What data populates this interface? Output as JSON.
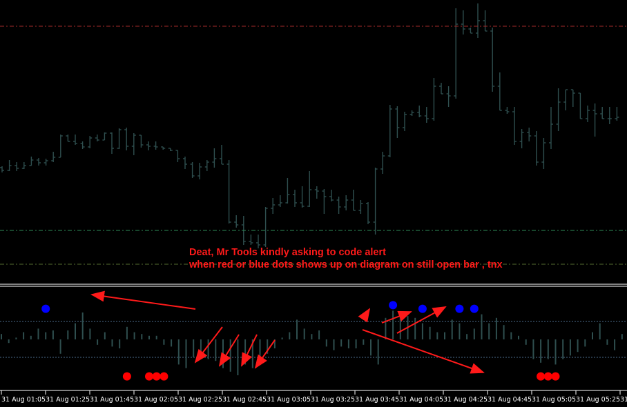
{
  "colors": {
    "background": "#000000",
    "price_bar": "#2f4f4f",
    "resistance_line": "#a52a2a",
    "support_line": "#2e8b57",
    "support_line_2": "#556b2f",
    "separator": "#ffffff",
    "histogram": "#2f4f4f",
    "level_line": "#4b6b8b",
    "dot_up": "#0000ff",
    "dot_down": "#ff0000",
    "annotation": "#ff1a1a",
    "axis_text": "#ffffff"
  },
  "annotation": {
    "line1": "Deat, Mr Tools kindly asking to code alert",
    "line2": "when red or blue dots shows up on diagram on still open bar , tnx"
  },
  "x_axis": {
    "labels": [
      "31 Aug 01:05",
      "31 Aug 01:25",
      "31 Aug 01:45",
      "31 Aug 02:05",
      "31 Aug 02:25",
      "31 Aug 02:45",
      "31 Aug 03:05",
      "31 Aug 03:25",
      "31 Aug 03:45",
      "31 Aug 04:05",
      "31 Aug 04:25",
      "31 Aug 04:45",
      "31 Aug 05:05",
      "31 Aug 05:25",
      "31"
    ]
  },
  "chart_data": [
    {
      "type": "bar",
      "description_free": true,
      "bar_interval_minutes": 1,
      "first_bar_time": "31 Aug 01:05",
      "ohlc": [
        [
          243,
          250,
          241,
          247
        ],
        [
          247,
          248,
          232,
          240
        ],
        [
          240,
          248,
          235,
          244
        ],
        [
          244,
          245,
          235,
          240
        ],
        [
          240,
          240,
          227,
          232
        ],
        [
          232,
          240,
          229,
          236
        ],
        [
          236,
          240,
          230,
          233
        ],
        [
          233,
          235,
          220,
          228
        ],
        [
          228,
          228,
          195,
          197
        ],
        [
          197,
          205,
          195,
          205
        ],
        [
          205,
          210,
          195,
          208
        ],
        [
          208,
          216,
          205,
          213
        ],
        [
          213,
          215,
          197,
          200
        ],
        [
          200,
          205,
          195,
          203
        ],
        [
          203,
          203,
          192,
          193
        ],
        [
          193,
          223,
          192,
          215
        ],
        [
          215,
          216,
          186,
          188
        ],
        [
          188,
          218,
          185,
          212
        ],
        [
          212,
          225,
          193,
          196
        ],
        [
          196,
          214,
          196,
          210
        ],
        [
          210,
          218,
          205,
          212
        ],
        [
          212,
          217,
          205,
          213
        ],
        [
          213,
          217,
          213,
          215
        ],
        [
          215,
          215,
          219,
          218
        ],
        [
          218,
          218,
          235,
          230
        ],
        [
          230,
          245,
          227,
          238
        ],
        [
          238,
          258,
          235,
          255
        ],
        [
          255,
          260,
          236,
          242
        ],
        [
          242,
          248,
          232,
          235
        ],
        [
          235,
          243,
          215,
          230
        ],
        [
          230,
          234,
          210,
          238
        ],
        [
          238,
          324,
          232,
          322
        ],
        [
          322,
          330,
          312,
          326
        ],
        [
          326,
          355,
          313,
          350
        ],
        [
          350,
          355,
          340,
          352
        ],
        [
          352,
          360,
          340,
          355
        ],
        [
          355,
          358,
          300,
          302
        ],
        [
          302,
          310,
          287,
          297
        ],
        [
          297,
          300,
          283,
          294
        ],
        [
          294,
          295,
          258,
          282
        ],
        [
          282,
          300,
          275,
          294
        ],
        [
          294,
          301,
          270,
          299
        ],
        [
          299,
          300,
          248,
          275
        ],
        [
          275,
          288,
          270,
          277
        ],
        [
          277,
          310,
          274,
          285
        ],
        [
          285,
          292,
          275,
          290
        ],
        [
          290,
          310,
          285,
          300
        ],
        [
          300,
          305,
          283,
          290
        ],
        [
          290,
          305,
          275,
          305
        ],
        [
          305,
          310,
          290,
          295
        ],
        [
          295,
          325,
          293,
          322
        ],
        [
          322,
          340,
          243,
          245
        ],
        [
          245,
          252,
          220,
          226
        ],
        [
          226,
          228,
          152,
          158
        ],
        [
          158,
          200,
          154,
          185
        ],
        [
          185,
          190,
          162,
          166
        ],
        [
          166,
          168,
          160,
          163
        ],
        [
          163,
          170,
          153,
          168
        ],
        [
          168,
          178,
          155,
          172
        ],
        [
          172,
          175,
          113,
          125
        ],
        [
          125,
          132,
          120,
          136
        ],
        [
          136,
          155,
          125,
          139
        ],
        [
          139,
          143,
          12,
          35
        ],
        [
          35,
          50,
          15,
          42
        ],
        [
          42,
          48,
          40,
          48
        ],
        [
          48,
          55,
          5,
          30
        ],
        [
          30,
          40,
          15,
          45
        ],
        [
          45,
          133,
          40,
          125
        ],
        [
          125,
          130,
          105,
          160
        ],
        [
          160,
          165,
          155,
          162
        ],
        [
          162,
          210,
          155,
          205
        ],
        [
          205,
          215,
          187,
          192
        ],
        [
          192,
          205,
          185,
          197
        ],
        [
          197,
          240,
          190,
          235
        ],
        [
          235,
          245,
          200,
          207
        ],
        [
          207,
          216,
          155,
          180
        ],
        [
          180,
          190,
          128,
          148
        ],
        [
          148,
          160,
          130,
          130
        ],
        [
          130,
          155,
          130,
          135
        ],
        [
          135,
          165,
          150,
          172
        ],
        [
          172,
          177,
          153,
          160
        ],
        [
          160,
          198,
          150,
          165
        ],
        [
          165,
          172,
          155,
          172
        ],
        [
          172,
          180,
          155,
          172
        ],
        [
          172,
          175,
          155,
          170
        ]
      ]
    },
    {
      "type": "bar",
      "description_free": true,
      "histogram_values": [
        0.3,
        -0.2,
        0.1,
        0.4,
        0.2,
        0.6,
        0.4,
        0.5,
        -0.8,
        0.5,
        0.9,
        1.5,
        0.6,
        -0.3,
        0.4,
        -0.4,
        -0.5,
        0.7,
        0.4,
        0.3,
        0.2,
        0.2,
        -0.3,
        -0.4,
        -1.4,
        -1.6,
        -1.0,
        -0.9,
        -1.1,
        -1.2,
        -1.6,
        -1.8,
        -2.0,
        -1.4,
        -1.6,
        -1.4,
        -0.8,
        -0.5,
        0.1,
        0.4,
        1.1,
        0.6,
        0.3,
        0.5,
        -0.4,
        -0.6,
        -0.4,
        -0.5,
        -0.5,
        -0.3,
        -0.9,
        -1.4,
        1.2,
        1.6,
        1.4,
        1.3,
        1.2,
        0.9,
        0.7,
        0.4,
        0.4,
        1.1,
        0.9,
        0.3,
        0.6,
        1.4,
        0.9,
        1.2,
        0.8,
        0.4,
        0.2,
        -0.3,
        -1.1,
        -1.3,
        -1.1,
        -1.4,
        -1.1,
        -0.9,
        -0.7,
        -0.4,
        0.4,
        0.9,
        -0.3,
        -0.6,
        0.3,
        -0.9,
        -1.1,
        -0.4
      ],
      "levels": [
        1.0,
        -1.0
      ],
      "dots_up_bar_index": [
        6,
        53,
        57,
        62,
        64
      ],
      "dots_down_bar_index": [
        17,
        20,
        21,
        22,
        73,
        74,
        75
      ]
    }
  ]
}
